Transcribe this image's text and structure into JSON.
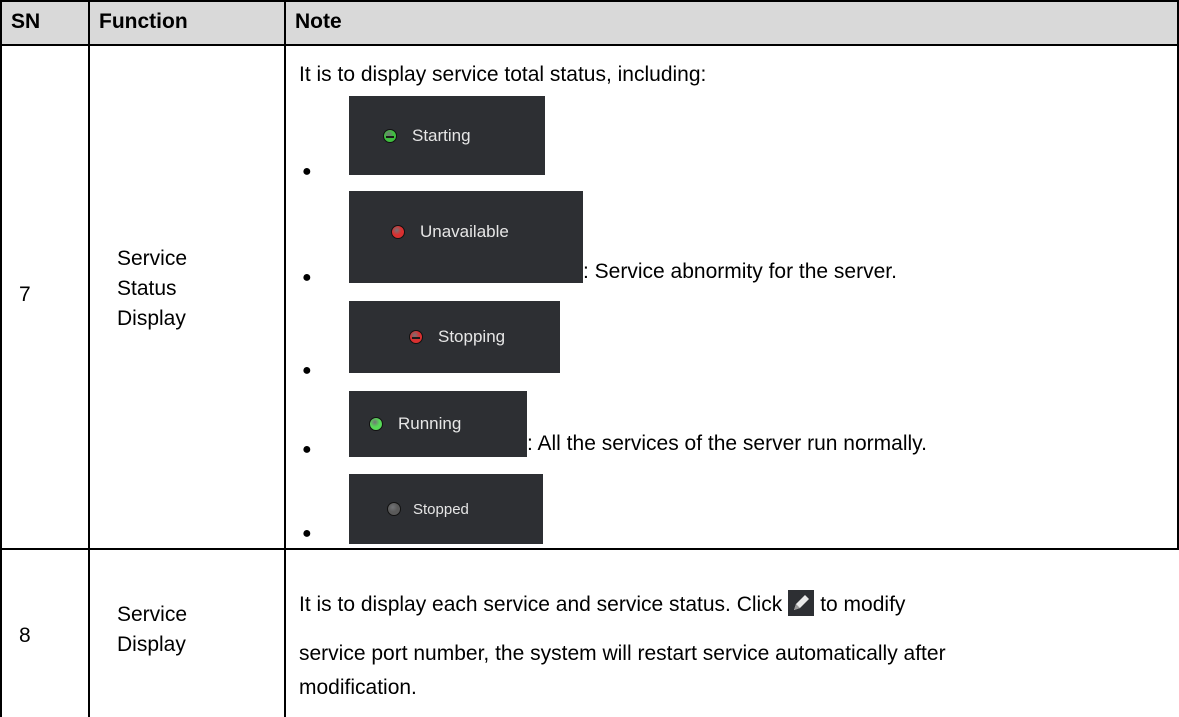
{
  "table": {
    "headers": {
      "sn": "SN",
      "function": "Function",
      "note": "Note"
    },
    "rows": [
      {
        "sn": "7",
        "function_lines": [
          "Service",
          "Status",
          "Display"
        ],
        "intro": "It is to display service total status, including:",
        "statuses": [
          {
            "label": "Starting",
            "description": "",
            "dot_color": "#3fbf3f",
            "icon": "minus-dot-icon"
          },
          {
            "label": "Unavailable",
            "description": ": Service abnormity for the server.",
            "dot_color": "#d93030",
            "icon": "dot-icon"
          },
          {
            "label": "Stopping",
            "description": "",
            "dot_color": "#d93030",
            "icon": "minus-dot-icon"
          },
          {
            "label": "Running",
            "description": ": All the services of the server run normally.",
            "dot_color": "#57d957",
            "icon": "dot-icon"
          },
          {
            "label": "Stopped",
            "description": "",
            "dot_color": "#5a5a5a",
            "icon": "dot-icon"
          }
        ]
      },
      {
        "sn": "8",
        "function_lines": [
          "Service",
          "Display"
        ],
        "note_lines": [
          "It is to display each service and service status. Click",
          "to modify",
          "service port number, the system will restart service automatically after",
          "modification."
        ],
        "icon": "edit-pencil-icon"
      }
    ]
  },
  "colors": {
    "header_bg": "#d9d9d9",
    "badge_bg": "#2d2f33",
    "badge_text": "#e6e6e6"
  }
}
